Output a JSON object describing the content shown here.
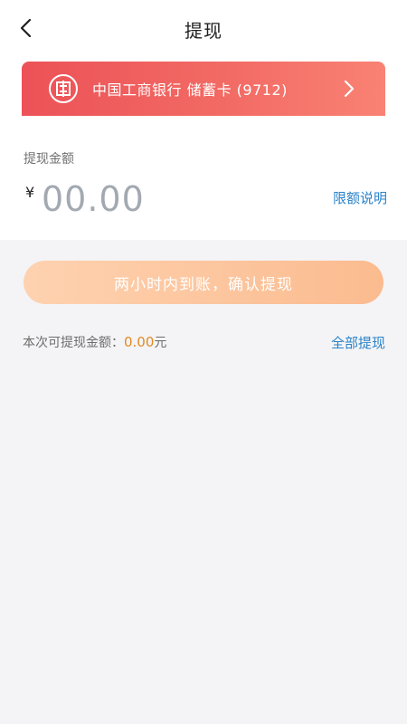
{
  "header": {
    "title": "提现",
    "back_icon": "chevron-left-icon"
  },
  "bank_card": {
    "bank_name": "中国工商银行 储蓄卡 (9712)",
    "logo_icon": "icbc-logo-icon",
    "chevron_icon": "chevron-right-icon",
    "gradient_start": "#ec5257",
    "gradient_end": "#f98274"
  },
  "amount": {
    "label": "提现金额",
    "currency_symbol": "¥",
    "placeholder": "00.00",
    "value": "",
    "limit_link": "限额说明"
  },
  "confirm_button": {
    "label": "两小时内到账，确认提现",
    "color_start": "#fed2b0",
    "color_end": "#fbbb8f"
  },
  "available": {
    "label": "本次可提现金额：",
    "amount": "0.00",
    "unit": "元",
    "withdraw_all": "全部提现"
  },
  "colors": {
    "link": "#2a82c8",
    "highlight": "#e38a22"
  }
}
